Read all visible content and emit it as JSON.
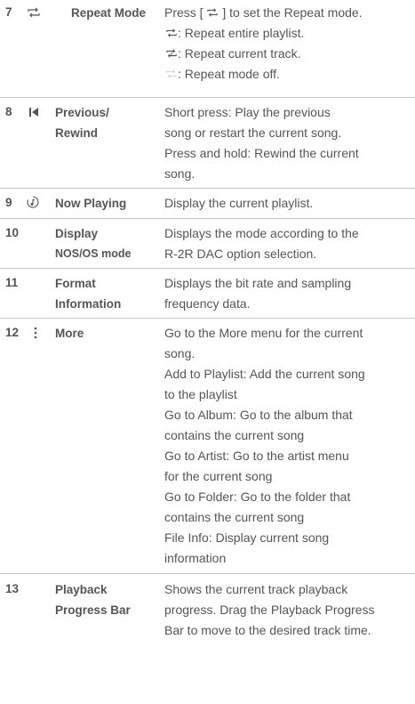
{
  "rows": [
    {
      "num": "7",
      "icon": "repeat-icon",
      "name": [
        "Repeat Mode"
      ],
      "desc": {
        "press_pre": "Press [ ",
        "press_post": " ] to set the Repeat mode.",
        "repeat_all": ": Repeat entire playlist.",
        "repeat_one": ": Repeat current track.",
        "repeat_off": ": Repeat mode off."
      }
    },
    {
      "num": "8",
      "icon": "previous-icon",
      "name": [
        "Previous/",
        "Rewind"
      ],
      "desc": [
        "Short press: Play the previous",
        "song or restart the current song.",
        "Press and hold: Rewind the current",
        "song."
      ]
    },
    {
      "num": "9",
      "icon": "now-playing-icon",
      "name": [
        "Now Playing"
      ],
      "desc": [
        "Display the current playlist."
      ]
    },
    {
      "num": "10",
      "name": [
        "Display",
        "NOS/OS mode"
      ],
      "desc": [
        "Displays the mode according to the",
        "R-2R DAC option selection."
      ]
    },
    {
      "num": "11",
      "name": [
        "Format",
        "Information"
      ],
      "desc": [
        "Displays the bit rate and sampling",
        "frequency data."
      ]
    },
    {
      "num": "12",
      "icon": "more-icon",
      "name": [
        "More"
      ],
      "desc": [
        "Go to the More menu for the current",
        "song.",
        "Add to Playlist: Add the current song",
        "to the playlist",
        "Go to Album: Go to the album that",
        "contains the current song",
        "Go to Artist: Go to the artist menu",
        "for the current song",
        "Go to Folder: Go to the folder that",
        "contains the current song",
        "File Info: Display current song",
        "information"
      ]
    },
    {
      "num": "13",
      "name": [
        "Playback",
        "Progress Bar"
      ],
      "desc": [
        "Shows the current track playback",
        "progress. Drag the Playback Progress",
        "Bar to move to the desired track time."
      ]
    }
  ],
  "colors": {
    "text": "#555555",
    "divider": "#c4c4c4",
    "icon_off": "#d8d8d8"
  }
}
